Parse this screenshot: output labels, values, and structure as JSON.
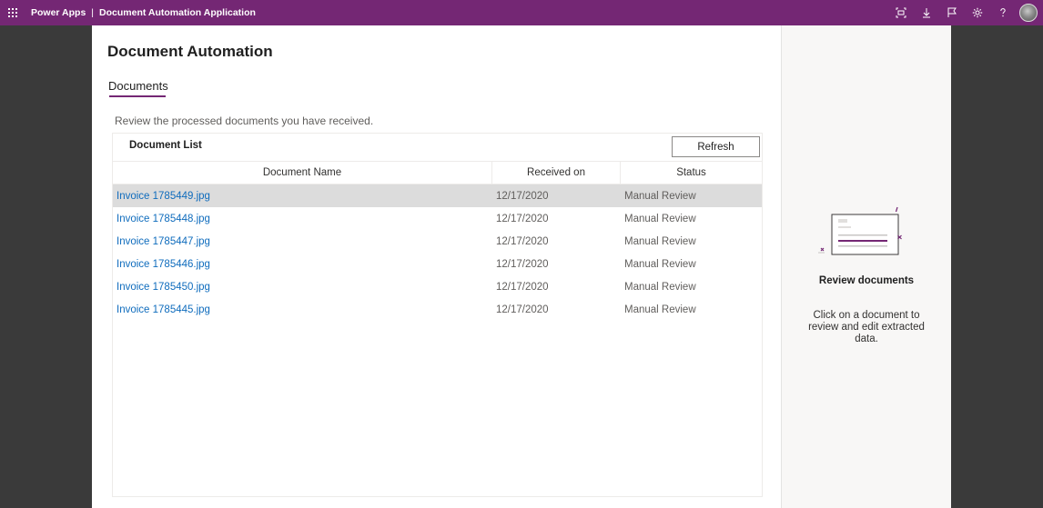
{
  "topbar": {
    "app_name": "Power Apps",
    "separator": "|",
    "app_title": "Document Automation Application",
    "icons": [
      "waffle-icon",
      "fit-screen-icon",
      "download-icon",
      "flag-icon",
      "settings-icon",
      "help-icon",
      "avatar"
    ]
  },
  "page": {
    "title": "Document Automation",
    "tab": "Documents",
    "description": "Review the processed documents you have received."
  },
  "document_list": {
    "title": "Document List",
    "refresh_label": "Refresh",
    "columns": {
      "name": "Document Name",
      "received": "Received on",
      "status": "Status"
    },
    "rows": [
      {
        "name": "Invoice 1785449.jpg",
        "received": "12/17/2020",
        "status": "Manual Review"
      },
      {
        "name": "Invoice 1785448.jpg",
        "received": "12/17/2020",
        "status": "Manual Review"
      },
      {
        "name": "Invoice 1785447.jpg",
        "received": "12/17/2020",
        "status": "Manual Review"
      },
      {
        "name": "Invoice 1785446.jpg",
        "received": "12/17/2020",
        "status": "Manual Review"
      },
      {
        "name": "Invoice 1785450.jpg",
        "received": "12/17/2020",
        "status": "Manual Review"
      },
      {
        "name": "Invoice 1785445.jpg",
        "received": "12/17/2020",
        "status": "Manual Review"
      }
    ]
  },
  "side_panel": {
    "title": "Review documents",
    "description": "Click on a document to review and edit extracted data."
  },
  "colors": {
    "brand": "#742774",
    "link": "#0f6cbd",
    "selected_row": "#dcdcdc",
    "backdrop": "#3a3a3a"
  }
}
